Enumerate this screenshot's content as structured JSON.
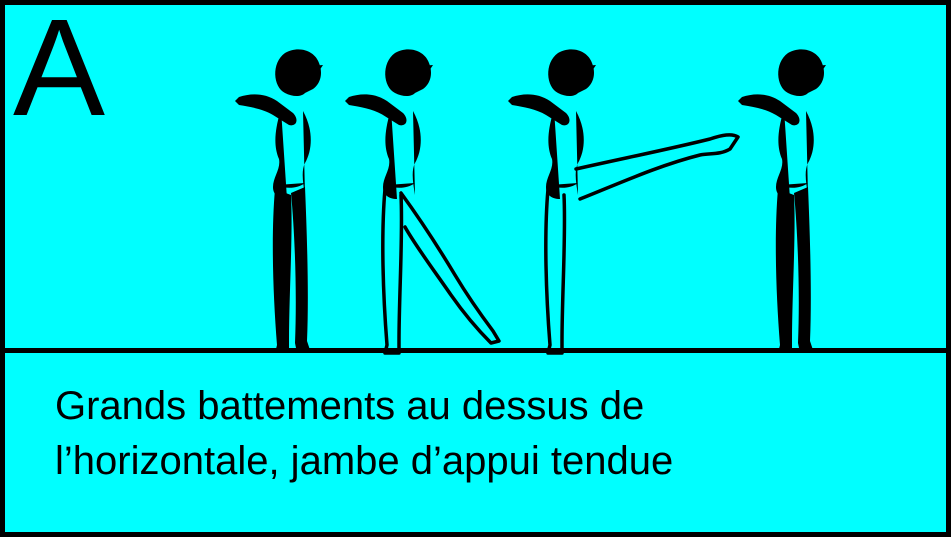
{
  "panel": {
    "label": "A",
    "caption_line1": "Grands battements au dessus de",
    "caption_line2": "l’horizontale, jambe d’appui tendue"
  },
  "colors": {
    "background": "#00ffff",
    "ink": "#000000"
  },
  "figures": [
    {
      "pose": "standing"
    },
    {
      "pose": "leg-back"
    },
    {
      "pose": "leg-front-raised"
    },
    {
      "pose": "standing"
    }
  ]
}
